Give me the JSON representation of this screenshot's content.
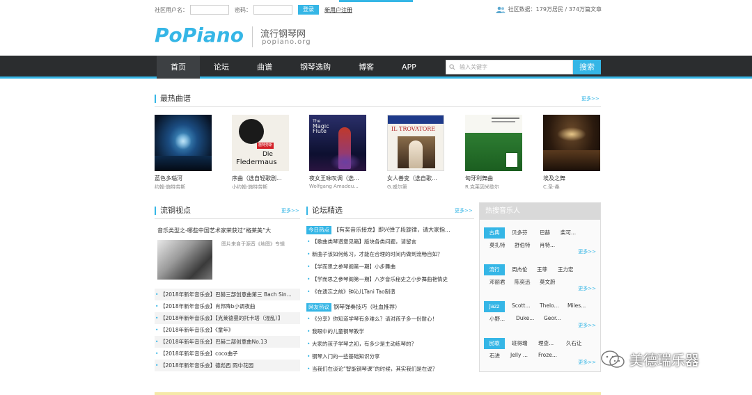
{
  "login": {
    "user_label": "社区用户名：",
    "pass_label": "密码：",
    "login_button": "登录",
    "register_link": "新用户注册"
  },
  "community_stats": "社区数据：179万居民 / 374万篇文章",
  "brand": {
    "logo": "PoPiano",
    "tagline": "流行钢琴网",
    "domain": "popiano.org",
    "accent": "#35b6e6"
  },
  "nav": {
    "items": [
      "首页",
      "论坛",
      "曲谱",
      "钢琴选购",
      "博客",
      "APP"
    ],
    "search_placeholder": "输入关键字",
    "search_button": "搜索"
  },
  "hot_scores": {
    "title": "最热曲谱",
    "more": "更多>>",
    "albums": [
      {
        "title": "蓝色多瑙河",
        "artist": "约翰·施特劳斯"
      },
      {
        "title": "序曲（选自轻歌剧...",
        "artist": "小约翰·施特劳斯"
      },
      {
        "title": "夜女王咏叹调（选...",
        "artist": "Wolfgang Amadeu..."
      },
      {
        "title": "女人善变（选自歌...",
        "artist": "G.威尔第"
      },
      {
        "title": "匈牙利舞曲",
        "artist": "R.克莱因米歇尔"
      },
      {
        "title": "埃及之舞",
        "artist": "C.圣-桑"
      }
    ],
    "cover_texts": {
      "fledermaus_top": "施特劳斯",
      "fledermaus_1": "Die",
      "fledermaus_2": "Fledermaus",
      "flute_1": "The",
      "flute_2": "Magic",
      "flute_3": "Flute",
      "trovatore": "IL TROVATORE"
    }
  },
  "views": {
    "title": "流钢视点",
    "more": "更多>>",
    "headline": "音乐类型之-哪些中国艺术家荣获过“格莱美”大",
    "caption": "图片来自于源音《地图》专辑",
    "items": [
      "【2018年新年音乐会】巴赫三部创意曲第三 Bach Sin...",
      "【2018年新年音乐会】肖邦降b小调夜曲",
      "【2018年新年音乐会】【克莱德曼的托卡塔（混乱）】",
      "【2018年新年音乐会】《童年》",
      "【2018年新年音乐会】巴赫二部创意曲No.13",
      "【2018年新年音乐会】coco曲子",
      "【2018年新年音乐会】德彪西 雨中花园"
    ]
  },
  "forum": {
    "title": "论坛精选",
    "more": "更多>>",
    "badge1": "今日热点",
    "headline1": "【有奖音乐接龙】即兴弹了段旋律，请大家指...",
    "items1": [
      "【歌曲类琴谱意见箱】版块各类问题，请留言",
      "新曲子该如何练习，才能在合理的时间内做到流畅自如？",
      "【学而思之参琴阁第一期】小步舞曲",
      "【学而思之参琴阁第一期】八岁音乐秘史之小步舞曲艳情史",
      "《在遗忘之前》钟沁儿Tani Tao制谱"
    ],
    "badge2": "网友热议",
    "headline2": "钢琴弹奏技巧（吐血推荐）",
    "items2": [
      "《分享》你知道学琴有多难么？请对孩子多一份耐心！",
      "我眼中的儿童钢琴教学",
      "大家的孩子学琴之初，有多少是主动练琴的？",
      "钢琴入门的一些基础知识分享",
      "当我们在谈论“智能钢琴课”的时候，其实我们是在说？"
    ]
  },
  "hot_musicians": {
    "title": "热搜音乐人",
    "more": "更多>>",
    "groups": [
      {
        "tag": "古典",
        "names": [
          "贝多芬",
          "巴赫",
          "柴可...",
          "莫扎特",
          "舒伯特",
          "肖特..."
        ]
      },
      {
        "tag": "流行",
        "names": [
          "周杰伦",
          "王菲",
          "王力宏",
          "邓丽君",
          "陈奕迅",
          "莫文蔚"
        ]
      },
      {
        "tag": "Jazz",
        "names": [
          "Scott...",
          "Thelo...",
          "Miles...",
          "小野...",
          "Duke...",
          "Geor..."
        ]
      },
      {
        "tag": "民歌",
        "names": [
          "班得瑞",
          "理查...",
          "久石让",
          "石进",
          "Jelly ...",
          "Froze..."
        ]
      }
    ]
  },
  "watermark": "美德瑞乐器"
}
